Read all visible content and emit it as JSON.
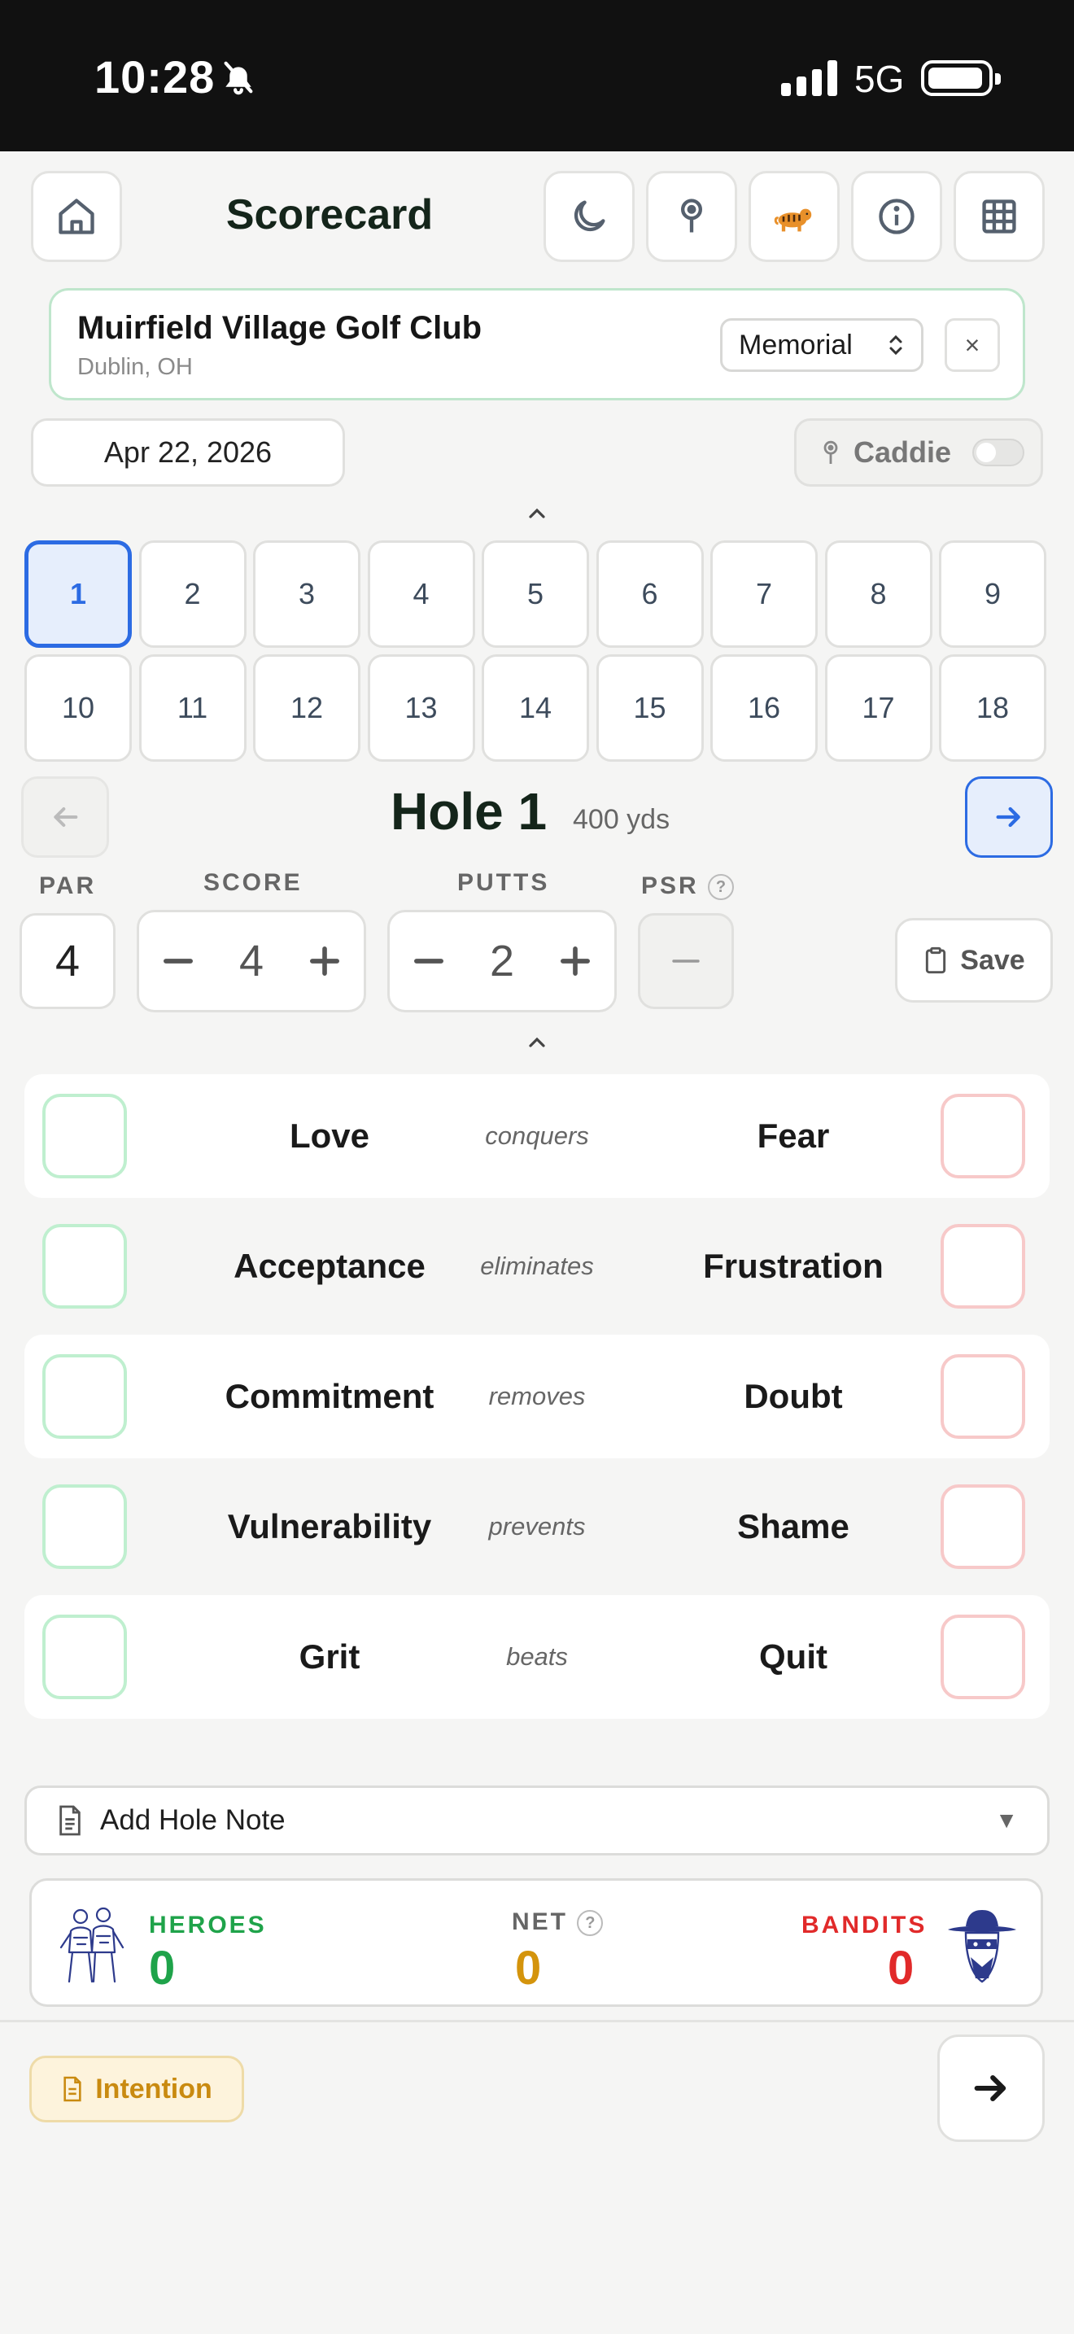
{
  "status_bar": {
    "time": "10:28",
    "network": "5G"
  },
  "header": {
    "title": "Scorecard",
    "icons": [
      "home-icon",
      "moon-icon",
      "map-pin-icon",
      "tiger-icon",
      "info-icon",
      "grid-icon"
    ]
  },
  "course": {
    "name": "Muirfield Village Golf Club",
    "location": "Dublin, OH",
    "tee": "Memorial",
    "clear_label": "×"
  },
  "round": {
    "date": "Apr 22, 2026",
    "caddie_label": "Caddie",
    "caddie_enabled": false
  },
  "holes": [
    "1",
    "2",
    "3",
    "4",
    "5",
    "6",
    "7",
    "8",
    "9",
    "10",
    "11",
    "12",
    "13",
    "14",
    "15",
    "16",
    "17",
    "18"
  ],
  "active_hole": 1,
  "hole": {
    "title": "Hole 1",
    "yardage": "400 yds"
  },
  "stats": {
    "par_label": "PAR",
    "par": "4",
    "score_label": "SCORE",
    "score": "4",
    "putts_label": "PUTTS",
    "putts": "2",
    "psr_label": "PSR",
    "psr": "–",
    "help": "?",
    "save_label": "Save"
  },
  "mantras": [
    {
      "positive": "Love",
      "verb": "conquers",
      "negative": "Fear"
    },
    {
      "positive": "Acceptance",
      "verb": "eliminates",
      "negative": "Frustration"
    },
    {
      "positive": "Commitment",
      "verb": "removes",
      "negative": "Doubt"
    },
    {
      "positive": "Vulnerability",
      "verb": "prevents",
      "negative": "Shame"
    },
    {
      "positive": "Grit",
      "verb": "beats",
      "negative": "Quit"
    }
  ],
  "note": {
    "label": "Add Hole Note",
    "arrow": "▼"
  },
  "tally": {
    "heroes_label": "HEROES",
    "heroes": "0",
    "net_label": "NET",
    "net": "0",
    "bandits_label": "BANDITS",
    "bandits": "0"
  },
  "footer": {
    "intention_label": "Intention"
  },
  "colors": {
    "accent_blue": "#2c6be3",
    "heroes_green": "#1fa34a",
    "net_gold": "#d4940c",
    "bandits_red": "#e12a2a",
    "intention_amber": "#c98a10"
  }
}
